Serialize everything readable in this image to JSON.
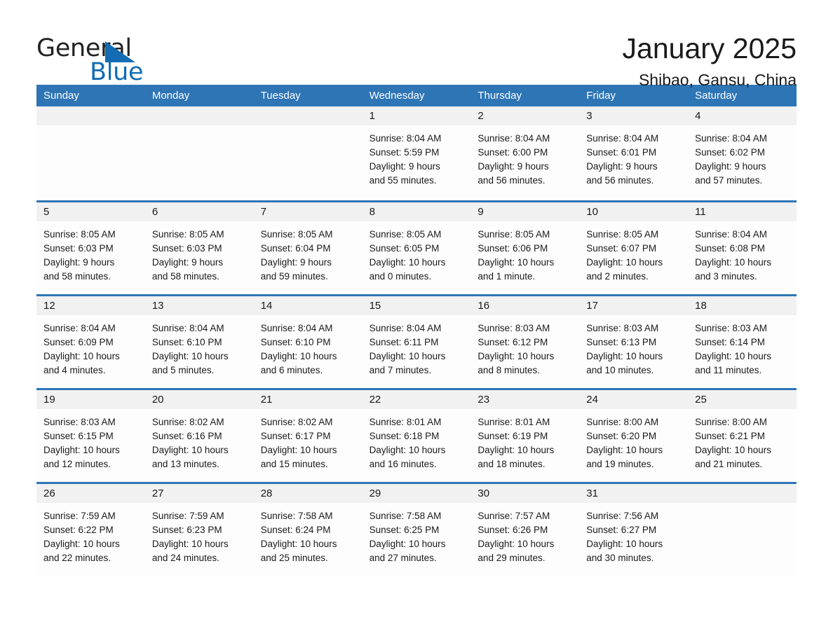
{
  "brand": {
    "word_one": "General",
    "word_two": "Blue",
    "triangle_icon": "triangle-right-icon",
    "accent_color": "#136cb4"
  },
  "header": {
    "month_title": "January 2025",
    "location": "Shibao, Gansu, China"
  },
  "theme": {
    "header_blue": "#2e75b6",
    "date_band_gray": "#f1f1f1",
    "cell_background": "#fdfdfd",
    "text_color": "#1a1a1a"
  },
  "weekdays": [
    "Sunday",
    "Monday",
    "Tuesday",
    "Wednesday",
    "Thursday",
    "Friday",
    "Saturday"
  ],
  "weeks": [
    [
      {
        "date": "",
        "lines": []
      },
      {
        "date": "",
        "lines": []
      },
      {
        "date": "",
        "lines": []
      },
      {
        "date": "1",
        "lines": [
          "Sunrise: 8:04 AM",
          "Sunset: 5:59 PM",
          "Daylight: 9 hours",
          "and 55 minutes."
        ]
      },
      {
        "date": "2",
        "lines": [
          "Sunrise: 8:04 AM",
          "Sunset: 6:00 PM",
          "Daylight: 9 hours",
          "and 56 minutes."
        ]
      },
      {
        "date": "3",
        "lines": [
          "Sunrise: 8:04 AM",
          "Sunset: 6:01 PM",
          "Daylight: 9 hours",
          "and 56 minutes."
        ]
      },
      {
        "date": "4",
        "lines": [
          "Sunrise: 8:04 AM",
          "Sunset: 6:02 PM",
          "Daylight: 9 hours",
          "and 57 minutes."
        ]
      }
    ],
    [
      {
        "date": "5",
        "lines": [
          "Sunrise: 8:05 AM",
          "Sunset: 6:03 PM",
          "Daylight: 9 hours",
          "and 58 minutes."
        ]
      },
      {
        "date": "6",
        "lines": [
          "Sunrise: 8:05 AM",
          "Sunset: 6:03 PM",
          "Daylight: 9 hours",
          "and 58 minutes."
        ]
      },
      {
        "date": "7",
        "lines": [
          "Sunrise: 8:05 AM",
          "Sunset: 6:04 PM",
          "Daylight: 9 hours",
          "and 59 minutes."
        ]
      },
      {
        "date": "8",
        "lines": [
          "Sunrise: 8:05 AM",
          "Sunset: 6:05 PM",
          "Daylight: 10 hours",
          "and 0 minutes."
        ]
      },
      {
        "date": "9",
        "lines": [
          "Sunrise: 8:05 AM",
          "Sunset: 6:06 PM",
          "Daylight: 10 hours",
          "and 1 minute."
        ]
      },
      {
        "date": "10",
        "lines": [
          "Sunrise: 8:05 AM",
          "Sunset: 6:07 PM",
          "Daylight: 10 hours",
          "and 2 minutes."
        ]
      },
      {
        "date": "11",
        "lines": [
          "Sunrise: 8:04 AM",
          "Sunset: 6:08 PM",
          "Daylight: 10 hours",
          "and 3 minutes."
        ]
      }
    ],
    [
      {
        "date": "12",
        "lines": [
          "Sunrise: 8:04 AM",
          "Sunset: 6:09 PM",
          "Daylight: 10 hours",
          "and 4 minutes."
        ]
      },
      {
        "date": "13",
        "lines": [
          "Sunrise: 8:04 AM",
          "Sunset: 6:10 PM",
          "Daylight: 10 hours",
          "and 5 minutes."
        ]
      },
      {
        "date": "14",
        "lines": [
          "Sunrise: 8:04 AM",
          "Sunset: 6:10 PM",
          "Daylight: 10 hours",
          "and 6 minutes."
        ]
      },
      {
        "date": "15",
        "lines": [
          "Sunrise: 8:04 AM",
          "Sunset: 6:11 PM",
          "Daylight: 10 hours",
          "and 7 minutes."
        ]
      },
      {
        "date": "16",
        "lines": [
          "Sunrise: 8:03 AM",
          "Sunset: 6:12 PM",
          "Daylight: 10 hours",
          "and 8 minutes."
        ]
      },
      {
        "date": "17",
        "lines": [
          "Sunrise: 8:03 AM",
          "Sunset: 6:13 PM",
          "Daylight: 10 hours",
          "and 10 minutes."
        ]
      },
      {
        "date": "18",
        "lines": [
          "Sunrise: 8:03 AM",
          "Sunset: 6:14 PM",
          "Daylight: 10 hours",
          "and 11 minutes."
        ]
      }
    ],
    [
      {
        "date": "19",
        "lines": [
          "Sunrise: 8:03 AM",
          "Sunset: 6:15 PM",
          "Daylight: 10 hours",
          "and 12 minutes."
        ]
      },
      {
        "date": "20",
        "lines": [
          "Sunrise: 8:02 AM",
          "Sunset: 6:16 PM",
          "Daylight: 10 hours",
          "and 13 minutes."
        ]
      },
      {
        "date": "21",
        "lines": [
          "Sunrise: 8:02 AM",
          "Sunset: 6:17 PM",
          "Daylight: 10 hours",
          "and 15 minutes."
        ]
      },
      {
        "date": "22",
        "lines": [
          "Sunrise: 8:01 AM",
          "Sunset: 6:18 PM",
          "Daylight: 10 hours",
          "and 16 minutes."
        ]
      },
      {
        "date": "23",
        "lines": [
          "Sunrise: 8:01 AM",
          "Sunset: 6:19 PM",
          "Daylight: 10 hours",
          "and 18 minutes."
        ]
      },
      {
        "date": "24",
        "lines": [
          "Sunrise: 8:00 AM",
          "Sunset: 6:20 PM",
          "Daylight: 10 hours",
          "and 19 minutes."
        ]
      },
      {
        "date": "25",
        "lines": [
          "Sunrise: 8:00 AM",
          "Sunset: 6:21 PM",
          "Daylight: 10 hours",
          "and 21 minutes."
        ]
      }
    ],
    [
      {
        "date": "26",
        "lines": [
          "Sunrise: 7:59 AM",
          "Sunset: 6:22 PM",
          "Daylight: 10 hours",
          "and 22 minutes."
        ]
      },
      {
        "date": "27",
        "lines": [
          "Sunrise: 7:59 AM",
          "Sunset: 6:23 PM",
          "Daylight: 10 hours",
          "and 24 minutes."
        ]
      },
      {
        "date": "28",
        "lines": [
          "Sunrise: 7:58 AM",
          "Sunset: 6:24 PM",
          "Daylight: 10 hours",
          "and 25 minutes."
        ]
      },
      {
        "date": "29",
        "lines": [
          "Sunrise: 7:58 AM",
          "Sunset: 6:25 PM",
          "Daylight: 10 hours",
          "and 27 minutes."
        ]
      },
      {
        "date": "30",
        "lines": [
          "Sunrise: 7:57 AM",
          "Sunset: 6:26 PM",
          "Daylight: 10 hours",
          "and 29 minutes."
        ]
      },
      {
        "date": "31",
        "lines": [
          "Sunrise: 7:56 AM",
          "Sunset: 6:27 PM",
          "Daylight: 10 hours",
          "and 30 minutes."
        ]
      },
      {
        "date": "",
        "lines": []
      }
    ]
  ]
}
